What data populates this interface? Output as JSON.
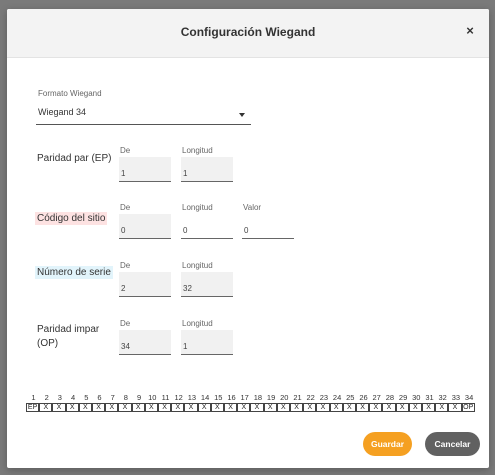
{
  "dialog": {
    "title": "Configuración Wiegand",
    "close_icon": "close-icon",
    "close_glyph": "×"
  },
  "format": {
    "label": "Formato Wiegand",
    "value": "Wiegand 34"
  },
  "rows": {
    "even_parity": {
      "label": "Paridad par (EP)",
      "de_label": "De",
      "de_value": "1",
      "len_label": "Longitud",
      "len_value": "1"
    },
    "site_code": {
      "label": "Código del sitio",
      "de_label": "De",
      "de_value": "0",
      "len_label": "Longitud",
      "len_value": "0",
      "val_label": "Valor",
      "val_value": "0",
      "highlight": "#fde2e2"
    },
    "serial": {
      "label": "Número de serie",
      "de_label": "De",
      "de_value": "2",
      "len_label": "Longitud",
      "len_value": "32",
      "highlight": "#e2f4fb"
    },
    "odd_parity": {
      "label_line1": "Paridad impar",
      "label_line2": "(OP)",
      "de_label": "De",
      "de_value": "34",
      "len_label": "Longitud",
      "len_value": "1"
    }
  },
  "bit_numbers": [
    "1",
    "2",
    "3",
    "4",
    "5",
    "6",
    "7",
    "8",
    "9",
    "10",
    "11",
    "12",
    "13",
    "14",
    "15",
    "16",
    "17",
    "18",
    "19",
    "20",
    "21",
    "22",
    "23",
    "24",
    "25",
    "26",
    "27",
    "28",
    "29",
    "30",
    "31",
    "32",
    "33",
    "34"
  ],
  "bits": [
    "EP",
    "X",
    "X",
    "X",
    "X",
    "X",
    "X",
    "X",
    "X",
    "X",
    "X",
    "X",
    "X",
    "X",
    "X",
    "X",
    "X",
    "X",
    "X",
    "X",
    "X",
    "X",
    "X",
    "X",
    "X",
    "X",
    "X",
    "X",
    "X",
    "X",
    "X",
    "X",
    "X",
    "OP"
  ],
  "buttons": {
    "save": "Guardar",
    "cancel": "Cancelar"
  },
  "colors": {
    "save": "#f5a021",
    "cancel": "#616161",
    "site_highlight": "#fde2e2",
    "serial_highlight": "#e2f4fb"
  }
}
